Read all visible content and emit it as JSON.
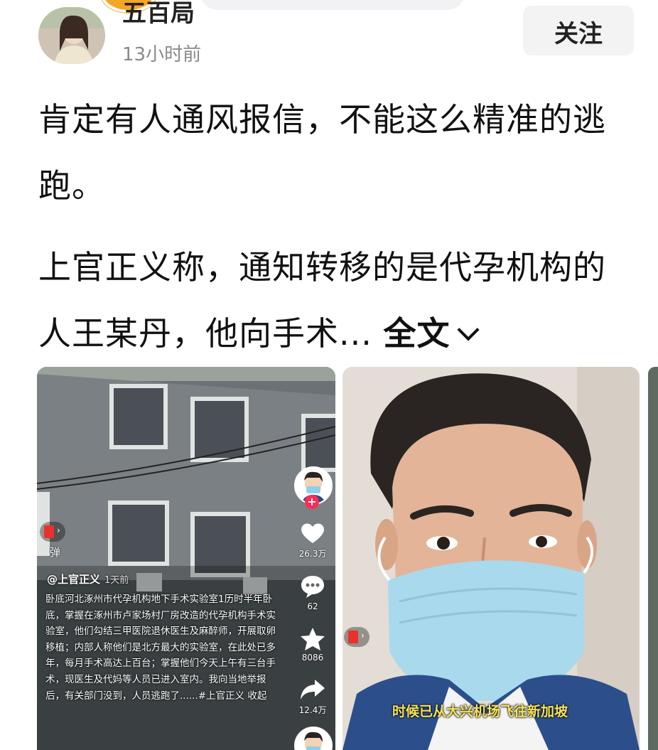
{
  "post": {
    "username": "五百局",
    "timestamp": "13小时前",
    "follow_label": "关注",
    "line1": "肯定有人通风报信，不能这么精准的逃跑。",
    "line2": "上官正义称，通知转移的是代孕机构的人王某丹，他向手术...",
    "expand_label": "全文"
  },
  "image1": {
    "danmu_label": "弹",
    "author": "@上官正义",
    "posted": "1天前",
    "description": "卧底河北涿州市代孕机构地下手术实验室1历时半年卧底，掌握在涿州市卢家场村厂房改造的代孕机构手术实验室，他们勾结三甲医院退休医生及麻醉师，开展取卵移植；内部人称他们是北方最大的实验室，在此处已多年，每月手术高达上百台；掌握他们今天上午有三台手术，现医生及代妈等人员已进入室内。我向当地举报后，有关部门没到，人员逃跑了......#上官正义  收起",
    "likes": "26.3万",
    "comments": "62",
    "favorites": "8086",
    "shares": "12.4万"
  },
  "image2": {
    "subtitle": "时候已从大兴机场飞往新加坡"
  },
  "colors": {
    "accent_red": "#fe2c55",
    "subtitle_yellow": "#f7e35a"
  }
}
